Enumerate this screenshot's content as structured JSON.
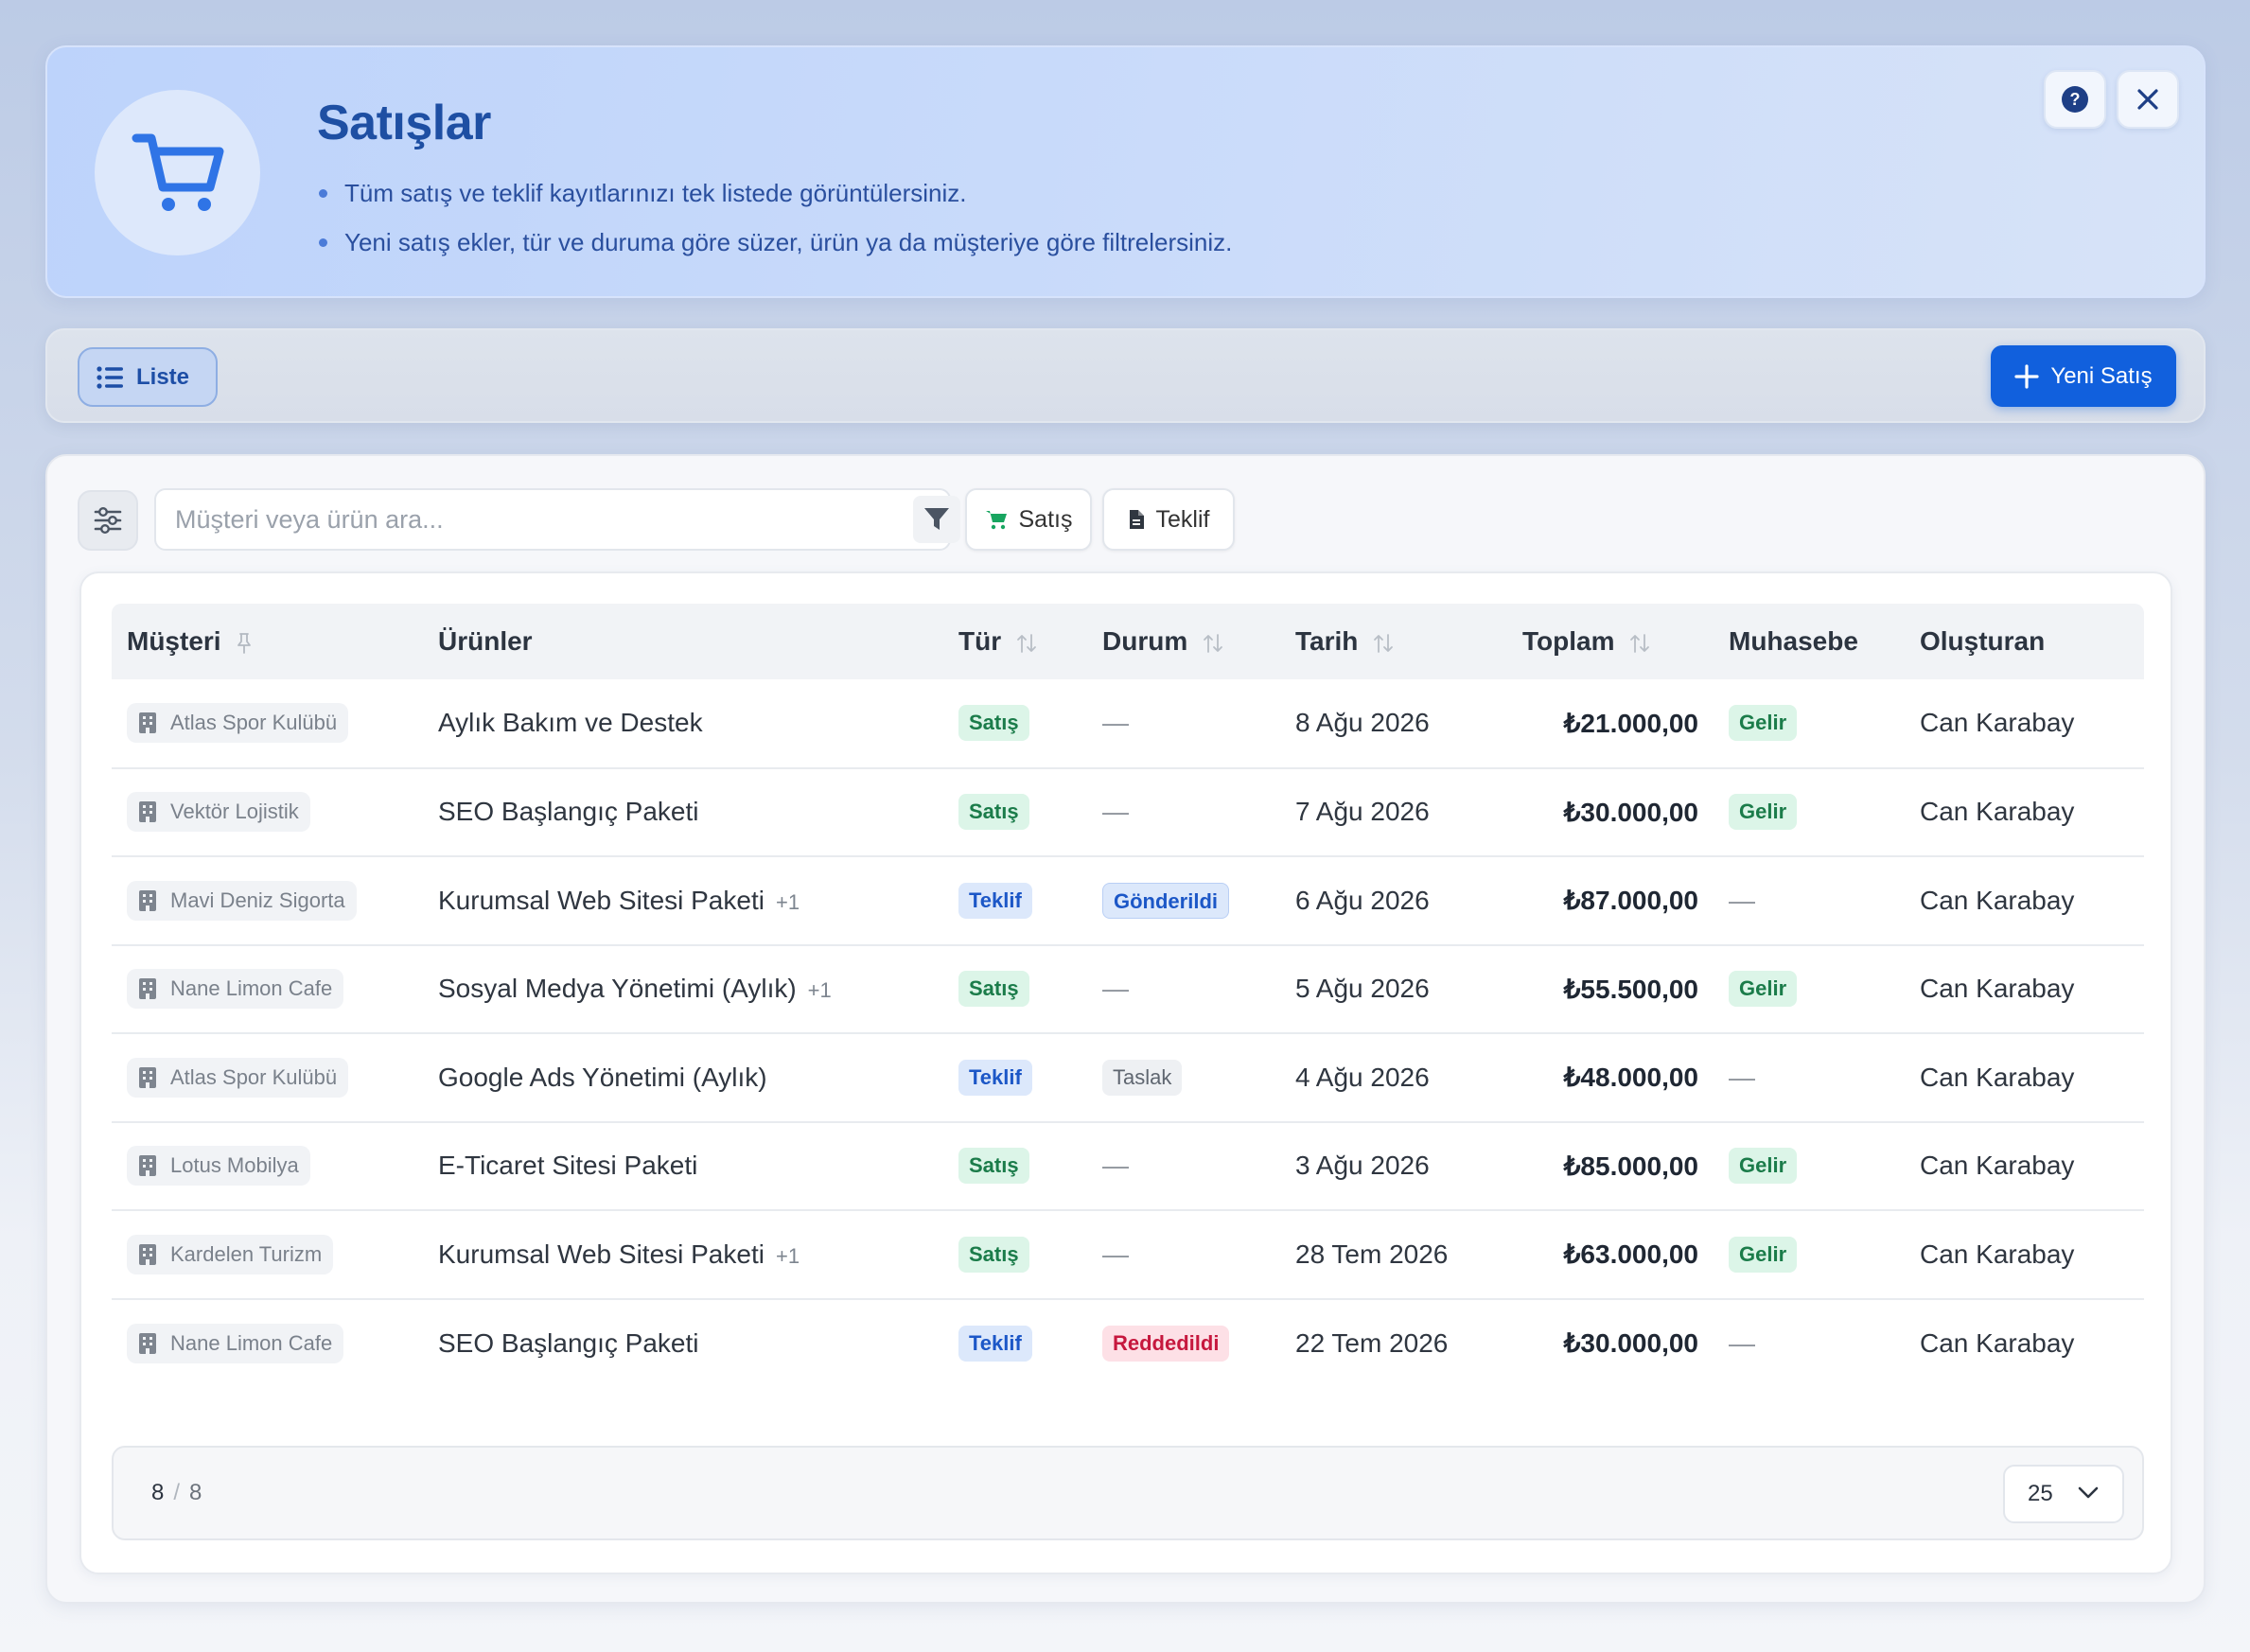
{
  "banner": {
    "title": "Satışlar",
    "bullets": [
      "Tüm satış ve teklif kayıtlarınızı tek listede görüntülersiniz.",
      "Yeni satış ekler, tür ve duruma göre süzer, ürün ya da müşteriye göre filtrelersiniz."
    ],
    "icon": "shopping-cart-icon",
    "help_icon": "question-circle-icon",
    "close_icon": "close-icon"
  },
  "toolbar": {
    "view_label": "Liste",
    "new_button_label": "Yeni Satış"
  },
  "filters": {
    "search_placeholder": "Müşteri veya ürün ara...",
    "chip_satis": "Satış",
    "chip_teklif": "Teklif"
  },
  "table": {
    "columns": [
      "Müşteri",
      "Ürünler",
      "Tür",
      "Durum",
      "Tarih",
      "Toplam",
      "Muhasebe",
      "Oluşturan"
    ],
    "rows": [
      {
        "customer": "Atlas Spor Kulübü",
        "product": "Aylık Bakım ve Destek",
        "extra": "",
        "type": "Satış",
        "status": "—",
        "date": "8 Ağu 2026",
        "total": "₺21.000,00",
        "accounting": "Gelir",
        "creator": "Can Karabay"
      },
      {
        "customer": "Vektör Lojistik",
        "product": "SEO Başlangıç Paketi",
        "extra": "",
        "type": "Satış",
        "status": "—",
        "date": "7 Ağu 2026",
        "total": "₺30.000,00",
        "accounting": "Gelir",
        "creator": "Can Karabay"
      },
      {
        "customer": "Mavi Deniz Sigorta",
        "product": "Kurumsal Web Sitesi Paketi",
        "extra": "+1",
        "type": "Teklif",
        "status": "Gönderildi",
        "date": "6 Ağu 2026",
        "total": "₺87.000,00",
        "accounting": "—",
        "creator": "Can Karabay"
      },
      {
        "customer": "Nane Limon Cafe",
        "product": "Sosyal Medya Yönetimi (Aylık)",
        "extra": "+1",
        "type": "Satış",
        "status": "—",
        "date": "5 Ağu 2026",
        "total": "₺55.500,00",
        "accounting": "Gelir",
        "creator": "Can Karabay"
      },
      {
        "customer": "Atlas Spor Kulübü",
        "product": "Google Ads Yönetimi (Aylık)",
        "extra": "",
        "type": "Teklif",
        "status": "Taslak",
        "date": "4 Ağu 2026",
        "total": "₺48.000,00",
        "accounting": "—",
        "creator": "Can Karabay"
      },
      {
        "customer": "Lotus Mobilya",
        "product": "E-Ticaret Sitesi Paketi",
        "extra": "",
        "type": "Satış",
        "status": "—",
        "date": "3 Ağu 2026",
        "total": "₺85.000,00",
        "accounting": "Gelir",
        "creator": "Can Karabay"
      },
      {
        "customer": "Kardelen Turizm",
        "product": "Kurumsal Web Sitesi Paketi",
        "extra": "+1",
        "type": "Satış",
        "status": "—",
        "date": "28 Tem 2026",
        "total": "₺63.000,00",
        "accounting": "Gelir",
        "creator": "Can Karabay"
      },
      {
        "customer": "Nane Limon Cafe",
        "product": "SEO Başlangıç Paketi",
        "extra": "",
        "type": "Teklif",
        "status": "Reddedildi",
        "date": "22 Tem 2026",
        "total": "₺30.000,00",
        "accounting": "—",
        "creator": "Can Karabay"
      }
    ]
  },
  "pager": {
    "shown": "8",
    "separator": "/",
    "total": "8",
    "page_size": "25"
  },
  "colors": {
    "primary": "#1160dd",
    "title": "#1e4fa3",
    "success": "#1b7c4a",
    "danger": "#c6183e"
  }
}
